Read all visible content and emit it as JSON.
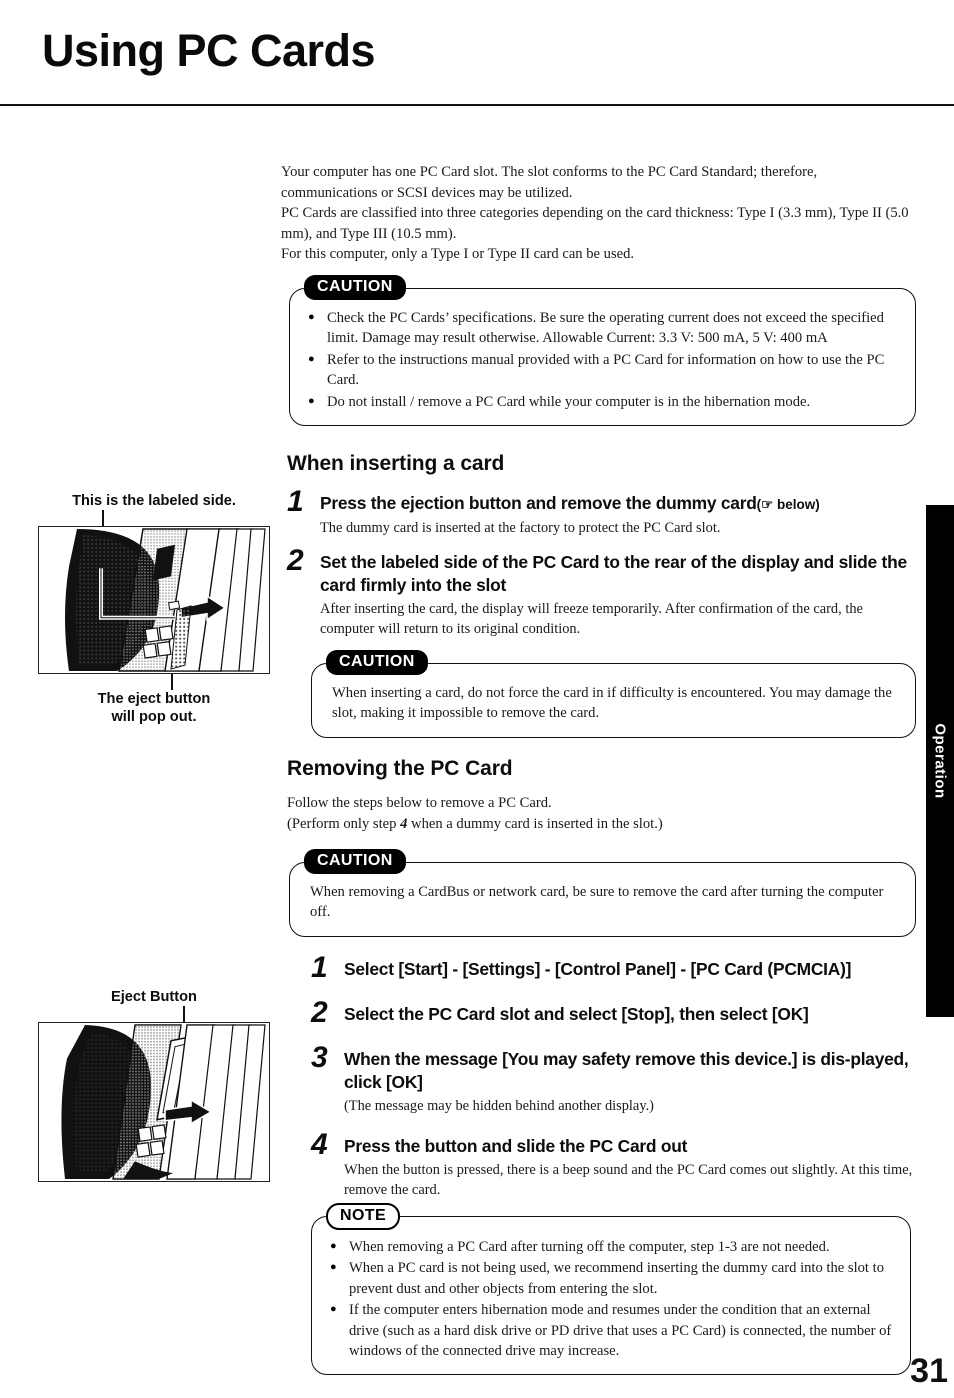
{
  "page": {
    "title": "Using PC Cards",
    "number": "31",
    "side_tab_label": "Operation"
  },
  "intro": {
    "lines": [
      "Your computer has one PC Card slot. The slot conforms to the PC Card Standard; therefore, communications or SCSI devices may be utilized.",
      "PC Cards are classified into three categories depending on the card thickness: Type I (3.3 mm), Type II (5.0 mm), and Type III (10.5 mm).",
      "For this computer, only a Type I or Type II card can be used."
    ]
  },
  "caution_top": {
    "badge": "CAUTION",
    "bullets": [
      "Check the PC Cards’ specifications.  Be sure the operating current does not exceed the specified limit.  Damage may result otherwise. Allowable Current: 3.3 V: 500 mA, 5 V: 400 mA",
      "Refer to the instructions manual provided with a PC Card for information on how to use the PC Card.",
      "Do not install / remove a PC Card while your computer is in the hibernation mode."
    ]
  },
  "inserting": {
    "heading": "When inserting a card",
    "steps": [
      {
        "num": "1",
        "title": "Press the ejection button and remove the dummy card",
        "suffix": "(☞ below)",
        "desc": "The dummy card is inserted at the factory to protect the PC Card slot."
      },
      {
        "num": "2",
        "title": "Set the labeled side of the PC Card to the rear of the display and slide the card firmly into the slot",
        "suffix": "",
        "desc": "After inserting the card, the display will freeze temporarily.  After confirmation of the card, the computer will return to its original condition."
      }
    ]
  },
  "caution_insert": {
    "badge": "CAUTION",
    "text": "When inserting a card, do not force the card in if difficulty is encountered.  You may damage the slot, making it impossible to remove the card."
  },
  "removing": {
    "heading": "Removing the PC Card",
    "lead_line1": "Follow the steps below to remove a PC Card.",
    "lead_line2_before": "(Perform only step ",
    "lead_line2_bold": "4",
    "lead_line2_after": " when a dummy card is inserted in the slot.)"
  },
  "caution_remove": {
    "badge": "CAUTION",
    "text": "When removing a CardBus or network card, be sure to remove the card after turning the computer off."
  },
  "removing_steps": [
    {
      "num": "1",
      "title": "Select [Start] - [Settings] - [Control Panel] - [PC Card (PCMCIA)]",
      "desc": ""
    },
    {
      "num": "2",
      "title": "Select the PC Card slot and select [Stop], then select [OK]",
      "desc": ""
    },
    {
      "num": "3",
      "title": "When the message [You may safety remove this device.] is dis-played, click [OK]",
      "desc": "(The message may be hidden behind another display.)"
    },
    {
      "num": "4",
      "title": "Press the button and slide the PC Card out",
      "desc": "When the button is pressed, there is a beep sound and the PC Card comes out slightly. At this time, remove the card."
    }
  ],
  "note": {
    "badge": "NOTE",
    "bullets": [
      "When removing a PC Card after turning off the computer, step 1-3 are not needed.",
      "When a PC card is not being used, we recommend inserting the dummy card into the slot to prevent dust and other objects from entering the slot.",
      "If the computer enters hibernation mode and resumes under the condition that an external drive (such as a hard disk drive or PD drive that uses a PC Card) is connected, the number of windows of the connected drive may increase."
    ]
  },
  "figures": {
    "figure_insert": {
      "caption_top": "This is the labeled side.",
      "caption_bottom_line1": "The eject button",
      "caption_bottom_line2": "will pop out."
    },
    "figure_eject": {
      "caption_top": "Eject Button"
    }
  }
}
